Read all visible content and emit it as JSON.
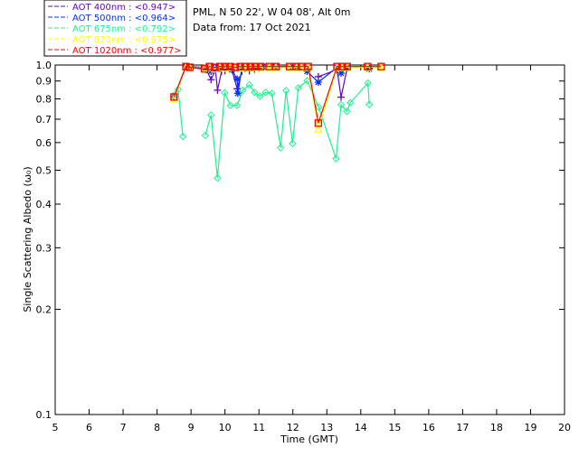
{
  "header": {
    "site": "PML, N 50 22', W 04 08', Alt 0m",
    "date": "Data from: 17 Oct 2021"
  },
  "chart_data": {
    "type": "line",
    "title": "",
    "xlabel": "Time (GMT)",
    "ylabel": "Single Scattering Albedo (ω₀)",
    "xlim": [
      5,
      20
    ],
    "ylim": [
      0.1,
      1.0
    ],
    "yscale": "log",
    "x_ticks": [
      "5",
      "6",
      "7",
      "8",
      "9",
      "10",
      "11",
      "12",
      "13",
      "14",
      "15",
      "16",
      "17",
      "18",
      "19",
      "20"
    ],
    "y_ticks": [
      "0.1",
      "0.2",
      "0.3",
      "0.4",
      "0.5",
      "0.6",
      "0.7",
      "0.8",
      "0.9",
      "1.0"
    ],
    "grid": false,
    "legend_position": "top-left",
    "series": [
      {
        "name": "AOT  400nm : <0.947>",
        "color": "#6a00c8",
        "marker": "plus",
        "x": [
          8.5,
          8.85,
          9.45,
          9.59,
          9.72,
          9.78,
          9.9,
          10.0,
          10.2,
          10.36,
          10.5,
          10.72,
          10.87,
          11.0,
          12.75,
          13.3,
          13.42,
          13.6,
          14.25
        ],
        "y": [
          0.81,
          0.99,
          0.97,
          0.908,
          0.97,
          0.847,
          0.96,
          0.963,
          0.97,
          0.855,
          0.96,
          0.963,
          0.973,
          0.98,
          0.926,
          0.97,
          0.809,
          0.982,
          0.98
        ]
      },
      {
        "name": "AOT  500nm : <0.964>",
        "color": "#0030ff",
        "marker": "star",
        "x": [
          8.5,
          8.85,
          9.45,
          9.59,
          9.72,
          9.9,
          10.0,
          10.2,
          10.36,
          10.38,
          10.5,
          10.72,
          10.9,
          11.1,
          11.5,
          12.0,
          12.42,
          12.75,
          13.3,
          13.42,
          13.6,
          14.25
        ],
        "y": [
          0.81,
          0.99,
          0.985,
          0.959,
          0.985,
          0.98,
          0.985,
          0.97,
          0.911,
          0.83,
          0.985,
          0.99,
          0.99,
          0.99,
          0.99,
          0.99,
          0.959,
          0.893,
          0.985,
          0.948,
          0.98,
          0.975
        ]
      },
      {
        "name": "AOT  675nm : <0.792>",
        "color": "#20f090",
        "marker": "diamond",
        "x": [
          8.51,
          8.62,
          8.76,
          9.42,
          9.59,
          9.78,
          9.99,
          10.16,
          10.36,
          10.52,
          10.72,
          10.87,
          11.03,
          11.2,
          11.38,
          11.64,
          11.8,
          11.99,
          12.16,
          12.42,
          12.76,
          13.27,
          13.42,
          13.59,
          13.69,
          14.21,
          14.25
        ],
        "y": [
          0.822,
          0.852,
          0.625,
          0.629,
          0.719,
          0.475,
          0.833,
          0.766,
          0.766,
          0.846,
          0.877,
          0.835,
          0.814,
          0.835,
          0.83,
          0.58,
          0.845,
          0.596,
          0.86,
          0.902,
          0.757,
          0.54,
          0.77,
          0.737,
          0.78,
          0.888,
          0.771
        ]
      },
      {
        "name": "AOT  870nm : <0.975>",
        "color": "#ffff00",
        "marker": "triangle",
        "x": [
          8.5,
          8.85,
          8.97,
          9.4,
          9.55,
          9.7,
          9.85,
          10.0,
          10.15,
          10.3,
          10.45,
          10.6,
          10.75,
          10.9,
          11.05,
          11.3,
          11.5,
          11.9,
          12.1,
          12.25,
          12.45,
          12.75,
          13.3,
          13.45,
          13.6,
          14.2,
          14.6
        ],
        "y": [
          0.8,
          0.985,
          0.985,
          0.98,
          0.985,
          0.975,
          0.985,
          0.98,
          0.985,
          0.985,
          0.98,
          0.985,
          0.985,
          0.985,
          0.985,
          0.985,
          0.985,
          0.985,
          0.985,
          0.985,
          0.985,
          0.657,
          0.985,
          0.985,
          0.985,
          0.985,
          0.985
        ]
      },
      {
        "name": "AOT 1020nm : <0.977>",
        "color": "#ff0000",
        "marker": "square",
        "x": [
          8.5,
          8.85,
          8.97,
          9.4,
          9.55,
          9.7,
          9.85,
          10.0,
          10.15,
          10.3,
          10.45,
          10.6,
          10.75,
          10.9,
          11.05,
          11.3,
          11.5,
          11.9,
          12.1,
          12.25,
          12.45,
          12.75,
          13.3,
          13.45,
          13.6,
          14.2,
          14.6
        ],
        "y": [
          0.81,
          0.99,
          0.985,
          0.975,
          0.99,
          0.985,
          0.99,
          0.99,
          0.99,
          0.985,
          0.99,
          0.99,
          0.99,
          0.99,
          0.99,
          0.99,
          0.99,
          0.99,
          0.99,
          0.99,
          0.99,
          0.682,
          0.99,
          0.99,
          0.99,
          0.99,
          0.99
        ]
      }
    ]
  }
}
